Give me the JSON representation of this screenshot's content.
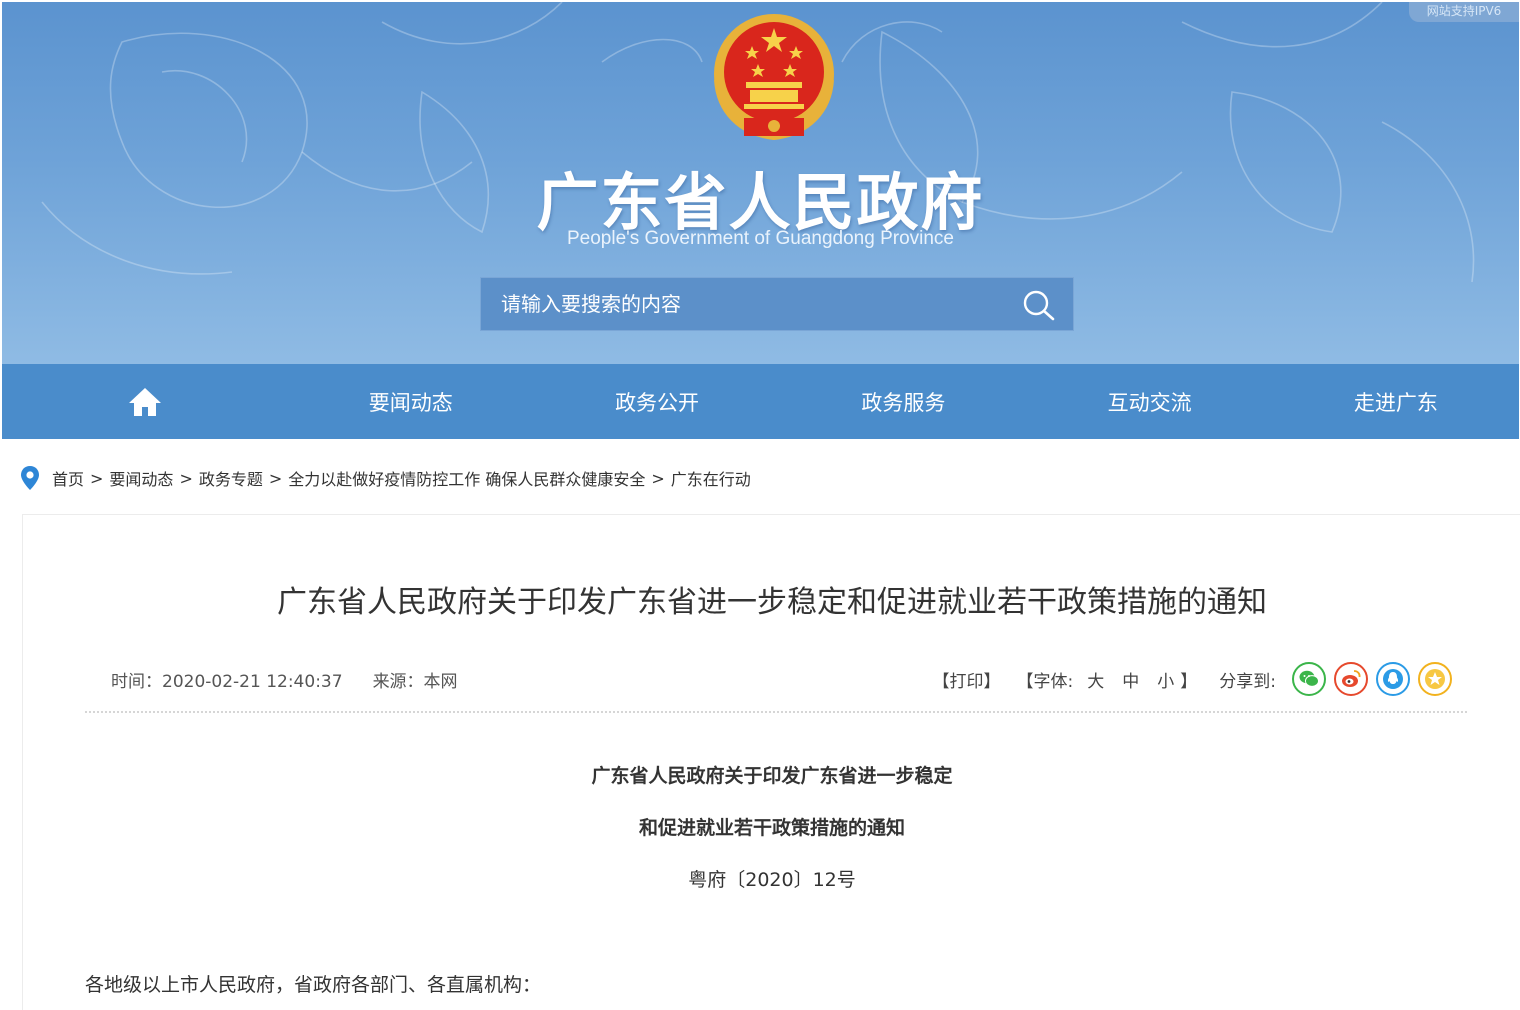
{
  "header": {
    "ipv6_badge": "网站支持IPV6",
    "title": "广东省人民政府",
    "subtitle": "People's Government of Guangdong Province",
    "search": {
      "placeholder": "请输入要搜索的内容"
    }
  },
  "nav": {
    "home_icon": "home-icon",
    "items": [
      {
        "label": "要闻动态"
      },
      {
        "label": "政务公开"
      },
      {
        "label": "政务服务"
      },
      {
        "label": "互动交流"
      },
      {
        "label": "走进广东"
      }
    ]
  },
  "breadcrumb": {
    "icon": "location-pin-icon",
    "items": [
      "首页",
      "要闻动态",
      "政务专题",
      "全力以赴做好疫情防控工作 确保人民群众健康安全",
      "广东在行动"
    ],
    "separator": ">"
  },
  "article": {
    "title": "广东省人民政府关于印发广东省进一步稳定和促进就业若干政策措施的通知",
    "meta": {
      "time": "时间：2020-02-21 12:40:37",
      "source": "来源：本网"
    },
    "tools": {
      "print": "【打印】",
      "font_open": "【字体:",
      "font_large": "大",
      "font_medium": "中",
      "font_small": "小",
      "font_close": "】",
      "share_label": "分享到:"
    },
    "share_icons": [
      "wechat-icon",
      "weibo-icon",
      "qq-icon",
      "qzone-icon"
    ],
    "doc_title_line1": "广东省人民政府关于印发广东省进一步稳定",
    "doc_title_line2": "和促进就业若干政策措施的通知",
    "doc_number": "粤府〔2020〕12号",
    "salutation": "各地级以上市人民政府，省政府各部门、各直属机构："
  },
  "colors": {
    "banner": "#6fa3d8",
    "nav": "#4a8ccb",
    "wechat": "#3bb54a",
    "weibo": "#e6492d",
    "qq": "#2b9be6",
    "qzone": "#f2b21e"
  }
}
